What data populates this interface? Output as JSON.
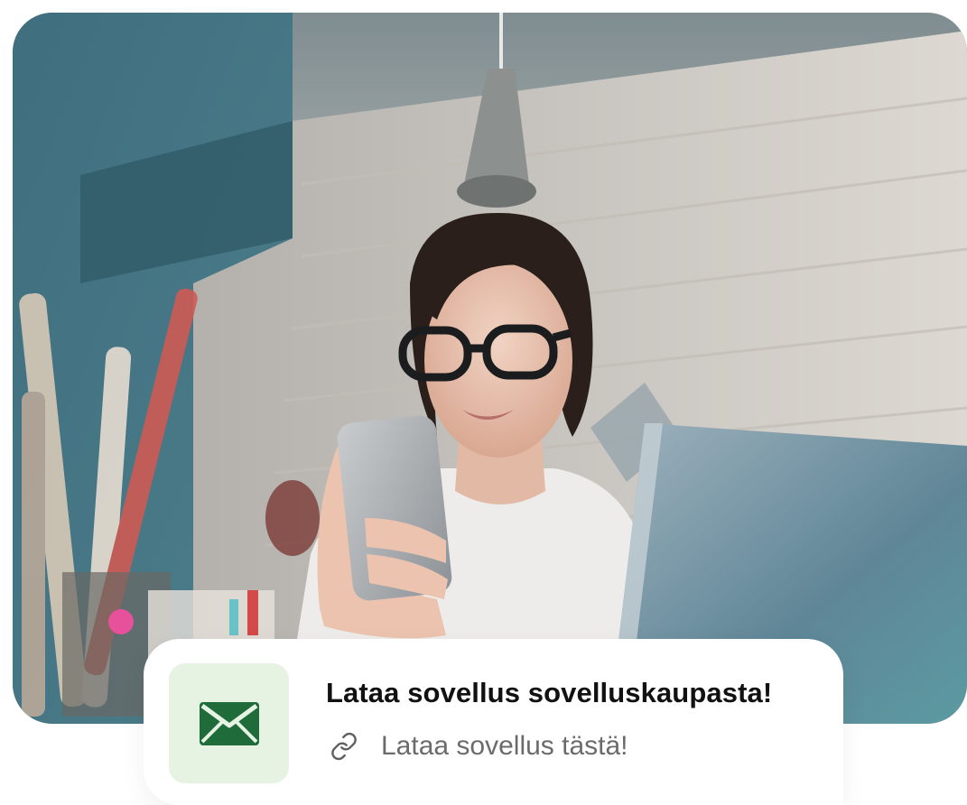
{
  "card": {
    "title": "Lataa sovellus sovelluskaupasta!",
    "link_text": "Lataa sovellus tästä!",
    "icon": "mail-icon",
    "link_icon": "link-icon"
  },
  "photo": {
    "subject": "woman-with-glasses-using-smartphone"
  },
  "colors": {
    "accent_green": "#1f6b3a",
    "icon_tile_bg": "#e6f2e2",
    "title_text": "#111111",
    "link_text": "#6b6b6b"
  }
}
